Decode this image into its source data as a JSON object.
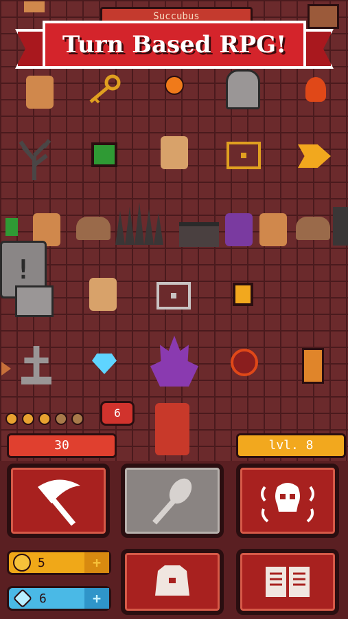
{
  "banner": {
    "title": "Turn Based RPG!"
  },
  "enemy": {
    "name": "Succubus"
  },
  "round": {
    "counter": "6",
    "hearts_filled": 3,
    "hearts_total": 5
  },
  "player": {
    "hp": "30",
    "level": "lvl. 8"
  },
  "actions": [
    {
      "name": "attack",
      "icon": "scythe-icon",
      "active": true
    },
    {
      "name": "magic",
      "icon": "spoon-icon",
      "active": false
    },
    {
      "name": "curse",
      "icon": "skull-icon",
      "active": true
    }
  ],
  "resources": {
    "gold": {
      "value": "5",
      "plus": "+"
    },
    "gems": {
      "value": "6",
      "plus": "+"
    }
  },
  "menu": [
    {
      "name": "inventory",
      "icon": "bag-icon"
    },
    {
      "name": "journal",
      "icon": "book-icon"
    }
  ],
  "colors": {
    "accent": "#d4242b",
    "floor": "#6b2a2c",
    "gold": "#f0a818",
    "gem": "#4ab9e6"
  }
}
